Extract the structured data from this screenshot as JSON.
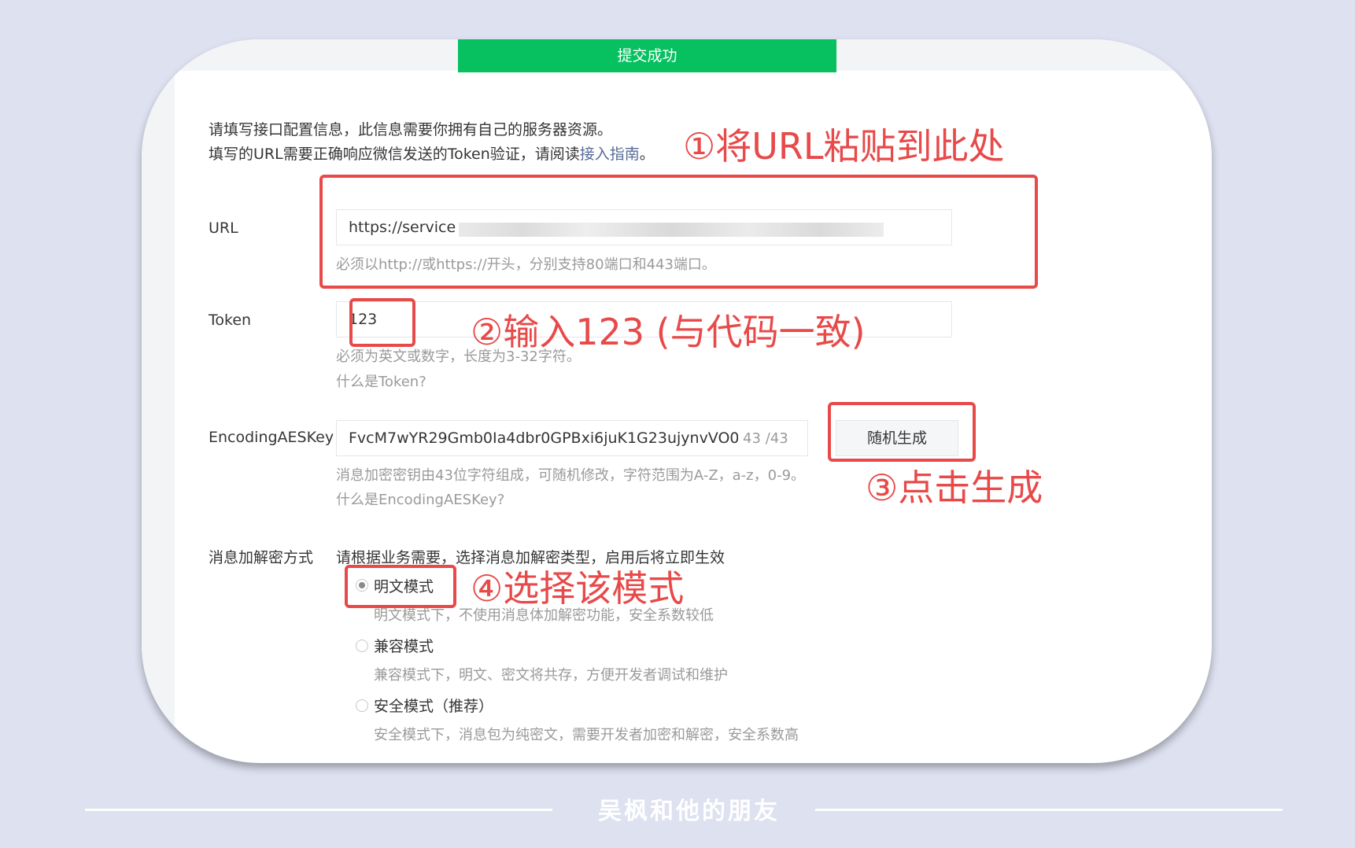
{
  "banner": "提交成功",
  "intro": {
    "line1": "请填写接口配置信息，此信息需要你拥有自己的服务器资源。",
    "line2_prefix": "填写的URL需要正确响应微信发送的Token验证，请阅读",
    "line2_link": "接入指南",
    "line2_suffix": "。"
  },
  "url": {
    "label": "URL",
    "value": "https://service",
    "hint": "必须以http://或https://开头，分别支持80端口和443端口。"
  },
  "token": {
    "label": "Token",
    "value": "123",
    "hint": "必须为英文或数字，长度为3-32字符。",
    "help_link": "什么是Token?"
  },
  "aes": {
    "label": "EncodingAESKey",
    "value": "FvcM7wYR29Gmb0Ia4dbr0GPBxi6juK1G23ujynvVO0",
    "count": "43",
    "count_sep": "/",
    "count_max": "43",
    "generate_button": "随机生成",
    "hint": "消息加密密钥由43位字符组成，可随机修改，字符范围为A-Z，a-z，0-9。",
    "help_link": "什么是EncodingAESKey?"
  },
  "mode": {
    "label": "消息加解密方式",
    "description": "请根据业务需要，选择消息加解密类型，启用后将立即生效",
    "options": [
      {
        "label": "明文模式",
        "desc": "明文模式下，不使用消息体加解密功能，安全系数较低",
        "checked": true
      },
      {
        "label": "兼容模式",
        "desc": "兼容模式下，明文、密文将共存，方便开发者调试和维护",
        "checked": false
      },
      {
        "label": "安全模式（推荐）",
        "desc": "安全模式下，消息包为纯密文，需要开发者加密和解密，安全系数高",
        "checked": false
      }
    ]
  },
  "annotations": {
    "step1": "①将URL粘贴到此处",
    "step2": "②输入123 (与代码一致)",
    "step3": "③点击生成",
    "step4": "④选择该模式",
    "color": "#e84949"
  },
  "footer": "吴枫和他的朋友",
  "colors": {
    "banner": "#07c160",
    "link": "#576b95",
    "background": "#dde1f0"
  }
}
